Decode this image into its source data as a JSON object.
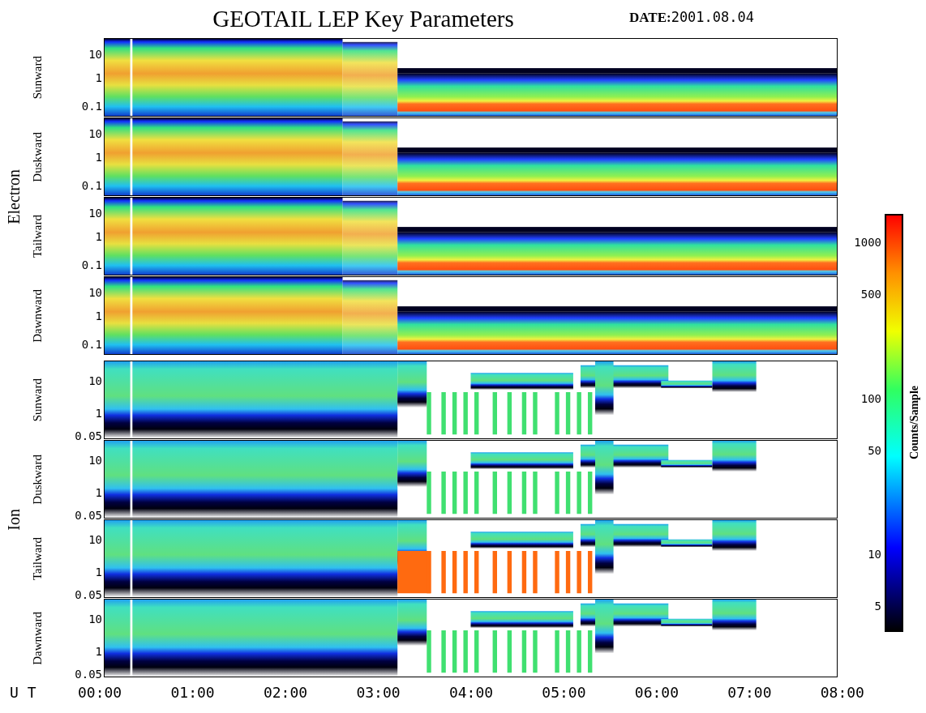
{
  "title": "GEOTAIL LEP Key Parameters",
  "date": {
    "label": "DATE:",
    "value": "2001.08.04"
  },
  "groups": [
    {
      "name": "Electron",
      "kind": "electron",
      "panels": [
        {
          "label": "Sunward",
          "y_ticks": [
            "10",
            "1",
            "0.1"
          ]
        },
        {
          "label": "Duskward",
          "y_ticks": [
            "10",
            "1",
            "0.1"
          ]
        },
        {
          "label": "Tailward",
          "y_ticks": [
            "10",
            "1",
            "0.1"
          ]
        },
        {
          "label": "Dawnward",
          "y_ticks": [
            "10",
            "1",
            "0.1"
          ]
        }
      ]
    },
    {
      "name": "Ion",
      "kind": "ion",
      "panels": [
        {
          "label": "Sunward",
          "y_ticks": [
            "10",
            "1",
            "0.05"
          ]
        },
        {
          "label": "Duskward",
          "y_ticks": [
            "10",
            "1",
            "0.05"
          ]
        },
        {
          "label": "Tailward",
          "y_ticks": [
            "10",
            "1",
            "0.05"
          ]
        },
        {
          "label": "Dawnward",
          "y_ticks": [
            "10",
            "1",
            "0.05"
          ]
        }
      ]
    }
  ],
  "x_axis": {
    "label": "U T",
    "ticks": [
      "00:00",
      "01:00",
      "02:00",
      "03:00",
      "04:00",
      "05:00",
      "06:00",
      "07:00",
      "08:00"
    ]
  },
  "colorbar": {
    "title": "Counts/Sample",
    "ticks": [
      "1000",
      "500",
      "100",
      "50",
      "10",
      "5"
    ]
  }
}
